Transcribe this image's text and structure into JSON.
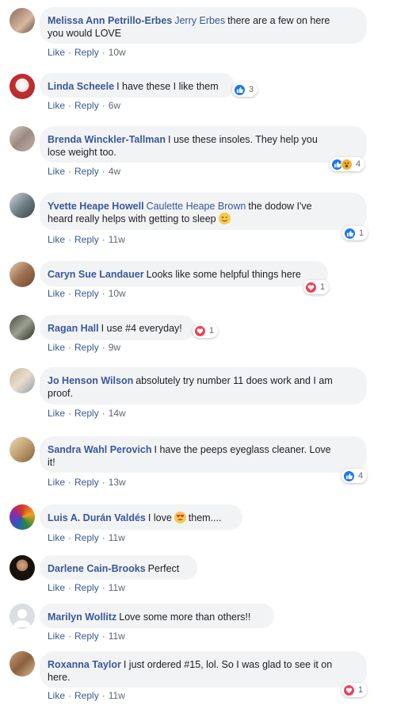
{
  "actions": {
    "like": "Like",
    "reply": "Reply",
    "sep": "·"
  },
  "comments": [
    {
      "author": "Melissa Ann Petrillo-Erbes",
      "mention": "Jerry Erbes",
      "text": "there are a few on here",
      "text2": "you would LOVE",
      "time": "10w"
    },
    {
      "author": "Linda Scheele",
      "text": "I have these I like them",
      "time": "6w",
      "react_count": "3"
    },
    {
      "author": "Brenda Winckler-Tallman",
      "text": "I use these insoles. They help you",
      "text2": "lose weight too.",
      "time": "4w",
      "react_count": "4"
    },
    {
      "author": "Yvette Heape Howell",
      "mention": "Caulette Heape Brown",
      "text": "the dodow I've",
      "text2": "heard really helps with getting to sleep",
      "time": "11w",
      "react_count": "1"
    },
    {
      "author": "Caryn Sue Landauer",
      "text": "Looks like some helpful things here",
      "time": "10w",
      "react_count": "1"
    },
    {
      "author": "Ragan Hall",
      "text": "I use #4 everyday!",
      "time": "9w",
      "react_count": "1"
    },
    {
      "author": "Jo Henson Wilson",
      "text": "absolutely try number 11 does work and I am",
      "text2": "proof.",
      "time": "14w"
    },
    {
      "author": "Sandra Wahl Perovich",
      "text": "I have the peeps eyeglass cleaner. Love",
      "text2": "it!",
      "time": "13w",
      "react_count": "4"
    },
    {
      "author": "Luis A. Durán Valdés",
      "text": "I love",
      "text_after": "them....",
      "time": "11w"
    },
    {
      "author": "Darlene Cain-Brooks",
      "text": "Perfect",
      "time": "11w"
    },
    {
      "author": "Marilyn Wollitz",
      "text": "Love some more than others!!",
      "time": "11w"
    },
    {
      "author": "Roxanna Taylor",
      "text": "I just ordered #15, lol. So I was glad to see it on",
      "text2": "here.",
      "time": "11w",
      "react_count": "1"
    }
  ],
  "colors": {
    "author": "#385898",
    "bubble": "#f2f3f5",
    "like": "#1877f2",
    "love": "#f33e58",
    "wow": "#f7b125"
  }
}
